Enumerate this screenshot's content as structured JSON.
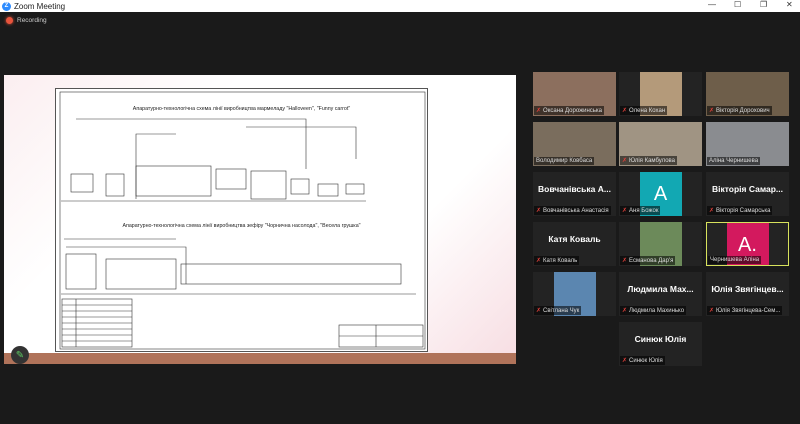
{
  "window": {
    "title": "Zoom Meeting",
    "recording": "Recording"
  },
  "slide": {
    "title1": "Апаратурно-технологічна схема лінії виробництва мармеладу \"Halloveen\", \"Funny carrot\"",
    "title2": "Апаратурно-технологічна схема лінії виробництва зефіру \"Чорнична насолода\", \"Весела грушка\""
  },
  "participants": [
    {
      "name": "Оксана Дорожинська",
      "type": "video",
      "muted": true
    },
    {
      "name": "Олена Кохан",
      "type": "video",
      "muted": true
    },
    {
      "name": "Вікторія Дорохович",
      "type": "video",
      "muted": true
    },
    {
      "name": "Володимир Ковбаса",
      "type": "video",
      "muted": false
    },
    {
      "name": "Юлія Камбулова",
      "type": "video",
      "muted": true
    },
    {
      "name": "Аліна Чернишева",
      "type": "video",
      "muted": false
    },
    {
      "name": "Вовчанівська Анастасія",
      "display": "Вовчанівська А...",
      "type": "name",
      "muted": true
    },
    {
      "name": "Аня Божок",
      "initial": "A",
      "color": "#12a8b3",
      "type": "avatar",
      "muted": true
    },
    {
      "name": "Вікторія Самарська",
      "display": "Вікторія Самар...",
      "type": "name",
      "muted": true
    },
    {
      "name": "Катя Коваль",
      "display": "Катя Коваль",
      "type": "name",
      "muted": true
    },
    {
      "name": "Есманова Дар'я",
      "type": "video",
      "muted": true
    },
    {
      "name": "Чернишева Аліна",
      "initial": "A.",
      "color": "#d3195e",
      "type": "avatar",
      "muted": false,
      "active": true
    },
    {
      "name": "Світлана Чук",
      "type": "video",
      "muted": true
    },
    {
      "name": "Людмила Махинько",
      "display": "Людмила Мах...",
      "type": "name",
      "muted": true
    },
    {
      "name": "Юлія Звягінцева-Сем...",
      "display": "Юлія Звягінцев...",
      "type": "name",
      "muted": true
    },
    {
      "name": "Синюк Юлія",
      "display": "Синюк Юлія",
      "type": "name",
      "muted": true
    }
  ]
}
